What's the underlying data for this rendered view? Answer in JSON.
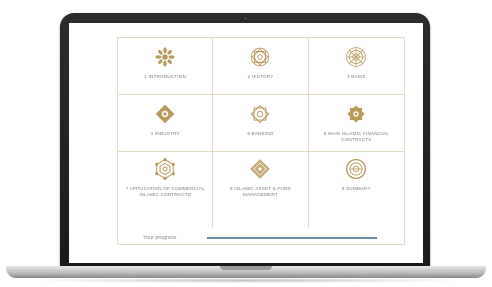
{
  "modules": [
    {
      "label": "1 INTRODUCTION",
      "icon": "eight-petal-flower-icon"
    },
    {
      "label": "2 HISTORY",
      "icon": "geometric-rosette-icon"
    },
    {
      "label": "3 BASIS",
      "icon": "radial-medallion-icon"
    },
    {
      "label": "4 INDUSTRY",
      "icon": "diamond-ornament-icon"
    },
    {
      "label": "5 BANKING",
      "icon": "star-knot-icon"
    },
    {
      "label": "6 MAIN ISLAMIC FINANCIAL CONTRACTS",
      "icon": "eight-point-star-icon"
    },
    {
      "label": "7 APPLICATION OF COMMERCIAL ISLAMIC CONTRACTS",
      "icon": "hexagon-lattice-icon"
    },
    {
      "label": "8 ISLAMIC ASSET & FUND MANAGEMENT",
      "icon": "rotated-square-icon"
    },
    {
      "label": "9 SUMMARY",
      "icon": "concentric-circle-icon"
    }
  ],
  "progress": {
    "label": "Your progress",
    "value_percent": 100
  },
  "colors": {
    "ornament_gold": "#b99a5b",
    "grid_line": "#e6dcc6",
    "progress_fill": "#6d8fa3",
    "label_gray": "#7a7a7a"
  }
}
